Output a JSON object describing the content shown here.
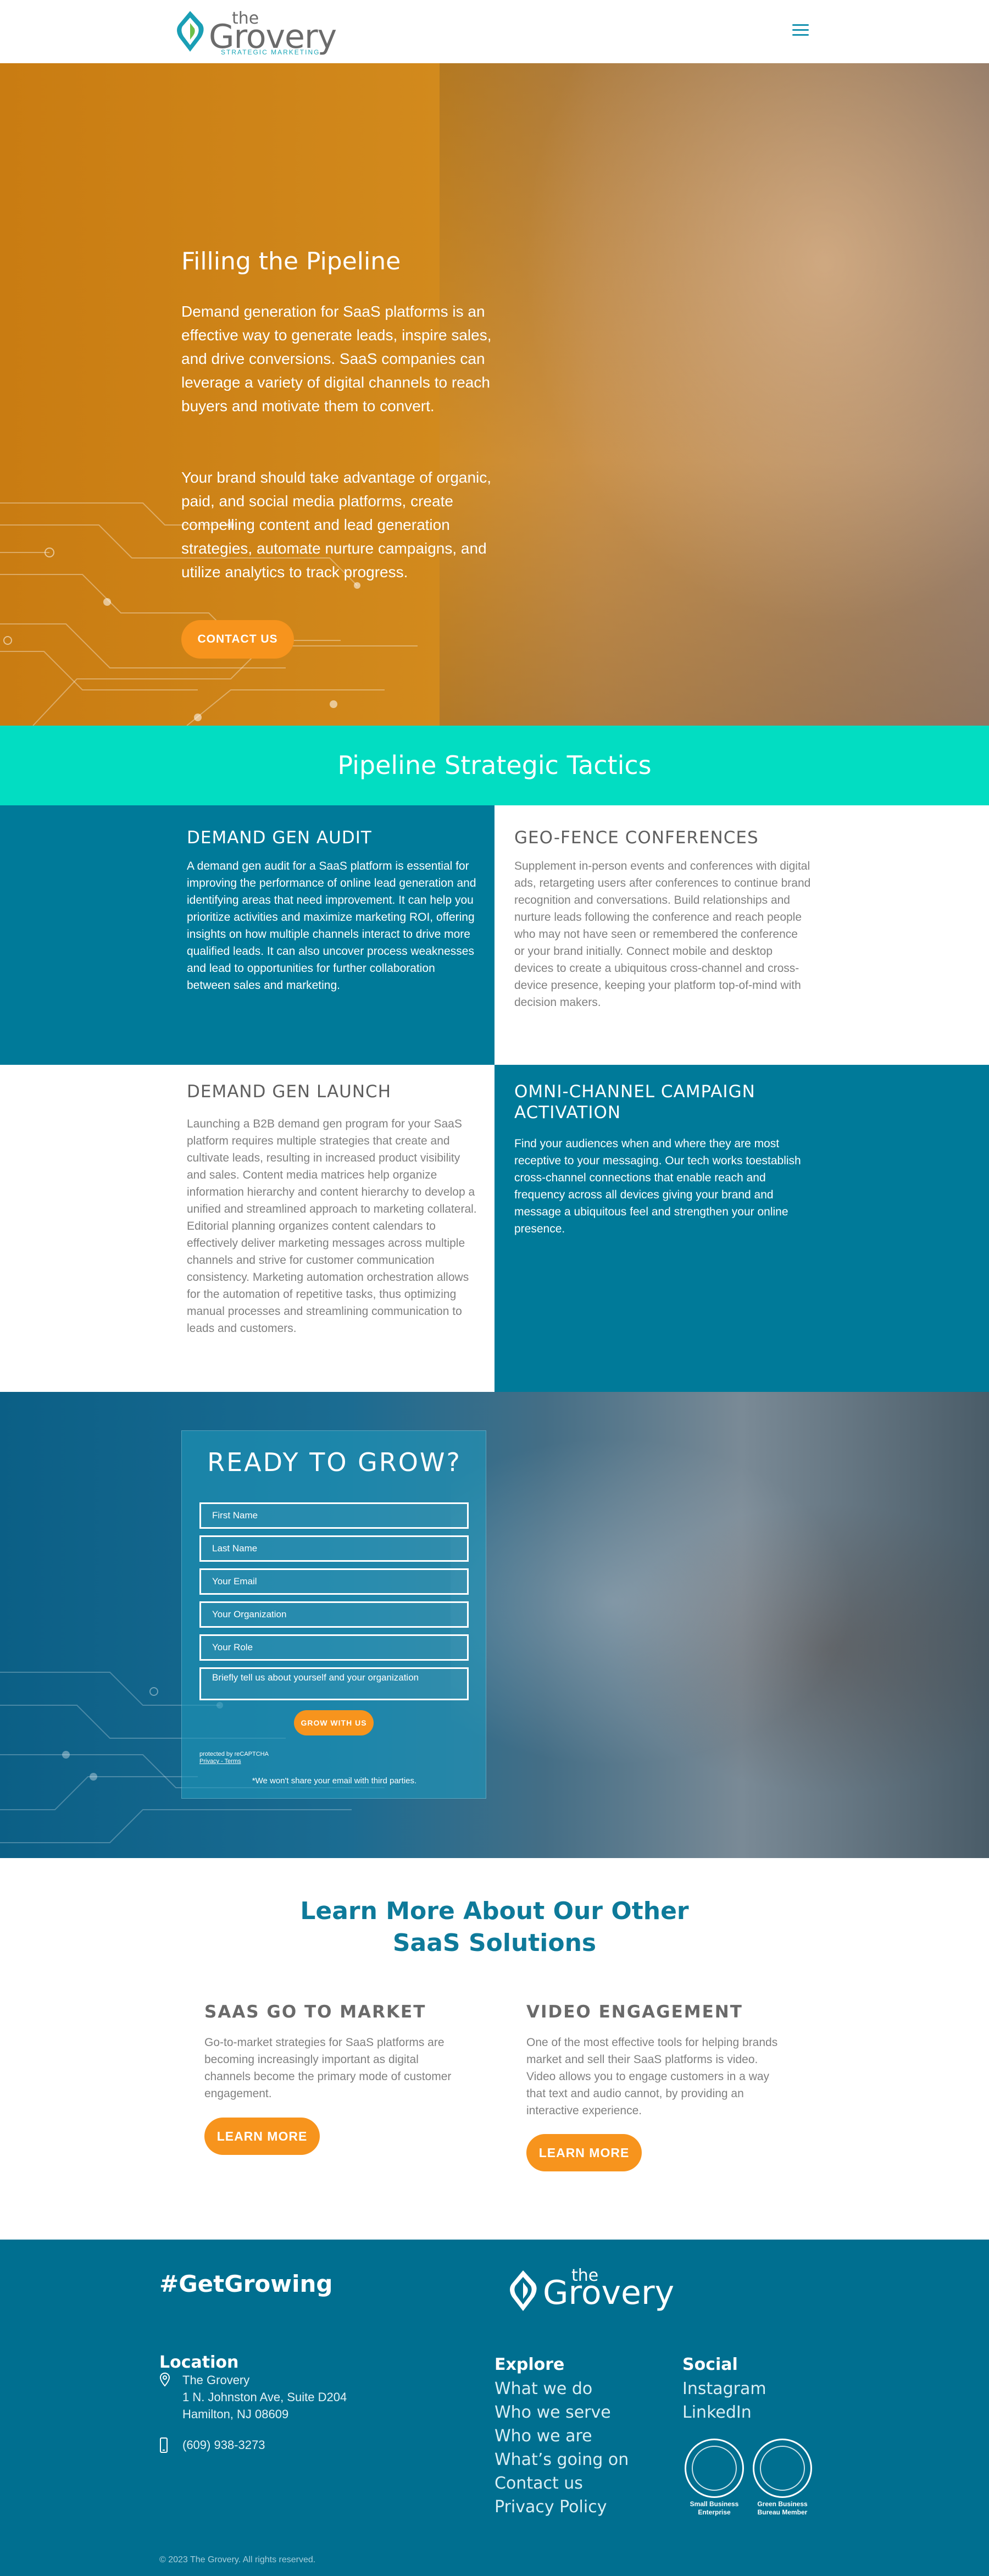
{
  "header": {
    "logo_the": "the",
    "logo_name": "Grovery",
    "logo_tag": "STRATEGIC MARKETING",
    "menu_icon": "hamburger-icon"
  },
  "hero": {
    "title": "Filling the Pipeline",
    "p1": "Demand generation for SaaS platforms is an effective way to generate leads, inspire sales, and drive conversions. SaaS companies can leverage a variety of digital channels to reach buyers and motivate them to convert.",
    "p2": "Your brand should take advantage of organic, paid, and social media platforms, create compelling content and lead generation strategies, automate nurture campaigns, and utilize analytics to track progress.",
    "button": "CONTACT US"
  },
  "tactics": {
    "title": "Pipeline Strategic Tactics",
    "items": [
      {
        "title": "DEMAND GEN AUDIT",
        "text": "A demand gen audit for a SaaS platform is essential for improving the performance of online lead generation and identifying areas that need improvement. It can help you prioritize activities and maximize marketing ROI, offering insights on how multiple channels interact to drive more qualified leads. It can also uncover process weaknesses and lead to opportunities for further collaboration between sales and marketing."
      },
      {
        "title": "GEO-FENCE CONFERENCES",
        "text": "Supplement in-person events and conferences with digital ads, retargeting users after conferences to continue brand recognition and conversations. Build relationships and nurture leads following the conference and reach people who may not have seen or remembered the conference or your brand initially. Connect mobile and desktop devices to create a ubiquitous cross-channel and cross-device presence, keeping your platform top-of-mind with decision makers."
      },
      {
        "title": "DEMAND GEN LAUNCH",
        "text": "Launching a B2B demand gen program for your SaaS platform requires multiple strategies that create and cultivate leads, resulting in increased product visibility and sales. Content media matrices help organize information hierarchy and content hierarchy to develop a unified and streamlined approach to marketing collateral. Editorial planning organizes content calendars to effectively deliver marketing messages across multiple channels and strive for customer communication consistency. Marketing automation orchestration allows for the automation of repetitive tasks, thus optimizing manual processes and streamlining communication to leads and customers."
      },
      {
        "title": "OMNI-CHANNEL CAMPAIGN ACTIVATION",
        "text": "Find your audiences when and where they are most receptive to your messaging. Our tech works toestablish cross-channel connections that enable reach and frequency across all devices giving your brand and message a ubiquitous feel and strengthen your online presence."
      }
    ]
  },
  "form": {
    "title": "READY TO GROW?",
    "fields": [
      "First Name",
      "Last Name",
      "Your Email",
      "Your Organization",
      "Your Role",
      "Briefly tell us about yourself and your organization"
    ],
    "button": "GROW WITH US",
    "recaptcha": "protected by reCAPTCHA",
    "recaptcha_links": "Privacy - Terms",
    "note": "*We won't share your email with third parties."
  },
  "learn": {
    "title_line1": "Learn More About Our Other",
    "title_line2": "SaaS Solutions",
    "items": [
      {
        "title": "SAAS GO TO MARKET",
        "text": "Go-to-market strategies for SaaS platforms are becoming increasingly important as digital channels become the primary mode of customer engagement.",
        "button": "LEARN MORE"
      },
      {
        "title": "VIDEO ENGAGEMENT",
        "text": "One of the most effective tools for helping brands market and sell their SaaS platforms is video. Video allows you to engage customers in a way that text and audio cannot, by providing an interactive experience.",
        "button": "LEARN MORE"
      }
    ]
  },
  "footer": {
    "hashtag": "#GetGrowing",
    "logo_the": "the",
    "logo_name": "Grovery",
    "location_title": "Location",
    "address1": "The Grovery",
    "address2": "1 N. Johnston Ave, Suite D204",
    "address3": "Hamilton, NJ 08609",
    "phone": "(609) 938-3273",
    "explore_title": "Explore",
    "explore_links": [
      "What we do",
      "Who we serve",
      "Who we are",
      "What’s going on",
      "Contact us",
      "Privacy Policy"
    ],
    "social_title": "Social",
    "social_links": [
      "Instagram",
      "LinkedIn"
    ],
    "badge1": "Small Business Enterprise",
    "badge2": "Green Business Bureau Member",
    "copyright": "© 2023 The Grovery. All rights reserved."
  },
  "colors": {
    "teal": "#007a99",
    "aqua": "#02ddc2",
    "orange": "#f7941d",
    "footer": "#006f90"
  }
}
